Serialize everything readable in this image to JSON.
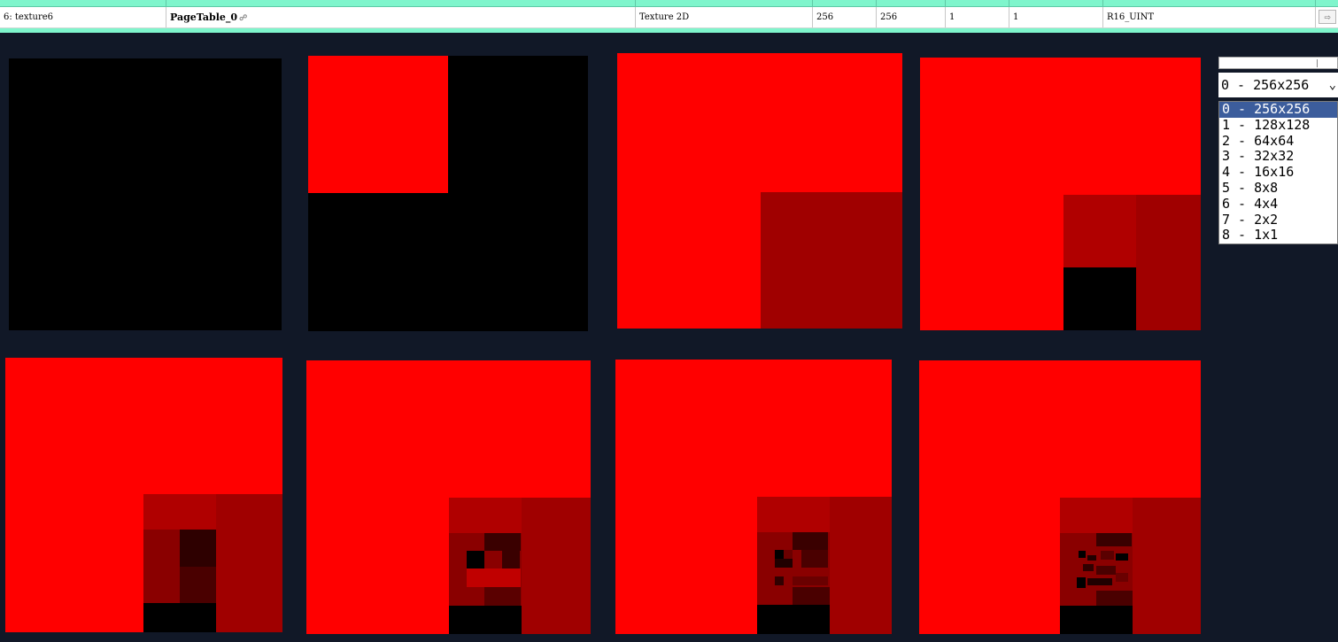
{
  "resource_row": {
    "name": "6: texture6",
    "label": "PageTable_0",
    "type": "Texture 2D",
    "width": "256",
    "height": "256",
    "depth": "1",
    "mips": "1",
    "format": "R16_UINT"
  },
  "icons": {
    "link": "link-icon",
    "goto": "go-arrow-icon",
    "dropdown": "chevron-down-icon"
  },
  "colors": {
    "background": "#111827",
    "red": "#ff0000",
    "dark_red": "#a00000",
    "black": "#000000",
    "table_header": "#7ff5cc",
    "selection": "#3c5d9c"
  },
  "mip_selector": {
    "selected_value": "0 - 256x256",
    "options": [
      "0 - 256x256",
      "1 - 128x128",
      "2 - 64x64",
      "3 - 32x32",
      "4 - 16x16",
      "5 - 8x8",
      "6 - 4x4",
      "7 - 2x2",
      "8 - 1x1"
    ],
    "highlighted_index": 0
  }
}
